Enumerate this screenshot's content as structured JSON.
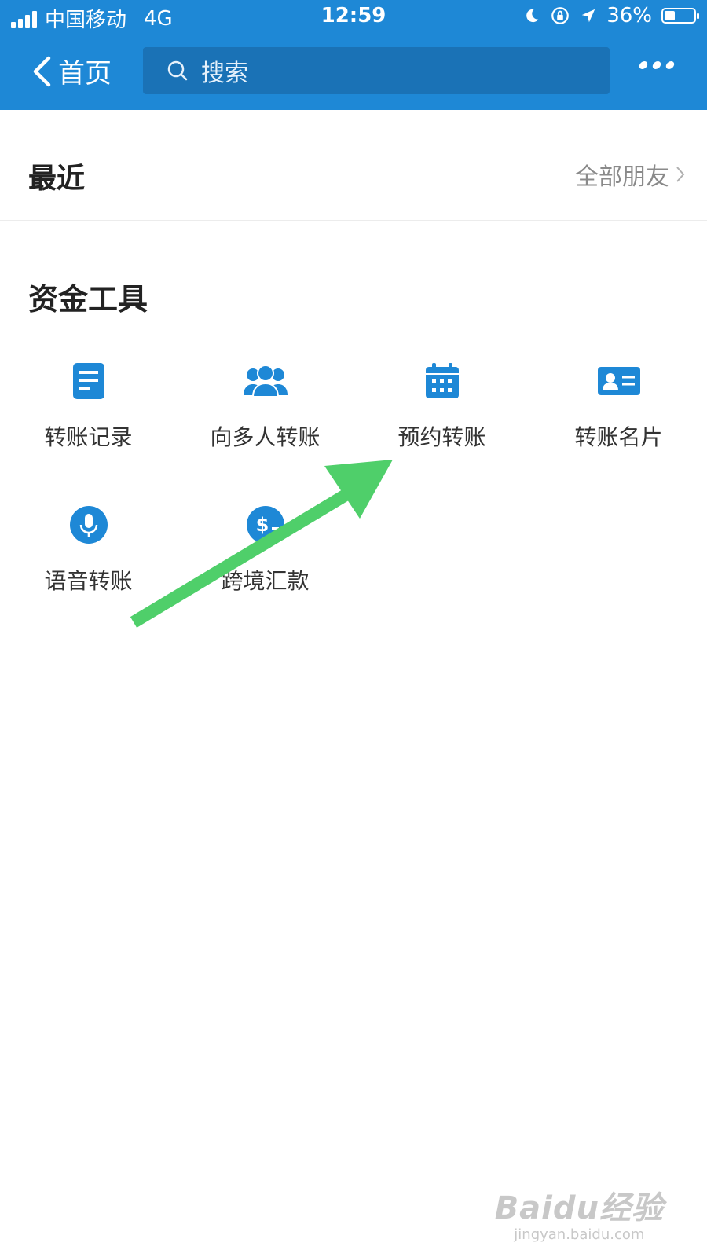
{
  "status_bar": {
    "carrier": "中国移动",
    "network": "4G",
    "time": "12:59",
    "battery": "36%",
    "battery_level": 0.36
  },
  "nav": {
    "back_label": "首页",
    "search_placeholder": "搜索",
    "accent_color": "#1e88d6"
  },
  "recent": {
    "title": "最近",
    "all_friends_label": "全部朋友"
  },
  "tools": {
    "title": "资金工具",
    "items": [
      {
        "label": "转账记录",
        "icon": "document-icon"
      },
      {
        "label": "向多人转账",
        "icon": "group-icon"
      },
      {
        "label": "预约转账",
        "icon": "calendar-icon"
      },
      {
        "label": "转账名片",
        "icon": "id-card-icon"
      },
      {
        "label": "语音转账",
        "icon": "microphone-icon"
      },
      {
        "label": "跨境汇款",
        "icon": "dollar-icon"
      }
    ]
  },
  "annotation": {
    "arrow_color": "#4fcf6a"
  },
  "watermark": {
    "brand": "Baidu经验",
    "domain": "jingyan.baidu.com"
  }
}
